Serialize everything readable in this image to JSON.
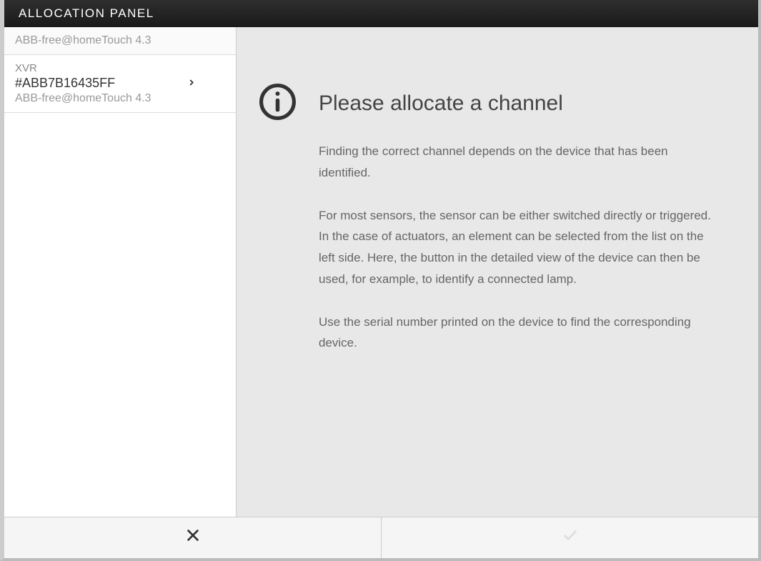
{
  "header": {
    "title": "ALLOCATION PANEL"
  },
  "sidebar": {
    "items": [
      {
        "label": "ABB-free@homeTouch 4.3"
      },
      {
        "line1": "XVR",
        "line2": "#ABB7B16435FF",
        "line3": "ABB-free@homeTouch 4.3"
      }
    ]
  },
  "content": {
    "title": "Please allocate a channel",
    "para1": "Finding the correct channel depends on the device that has been identified.",
    "para2": "For most sensors, the sensor can be either switched directly or triggered. In the case of actuators, an element can be selected from the list on the left side. Here, the button in the detailed view of the device can then be used, for example, to identify a connected lamp.",
    "para3": "Use the serial number printed on the device to find the corresponding device."
  },
  "icons": {
    "info": "info-icon",
    "cancel": "close-icon",
    "confirm": "check-icon",
    "chevron": "chevron-right-icon"
  }
}
